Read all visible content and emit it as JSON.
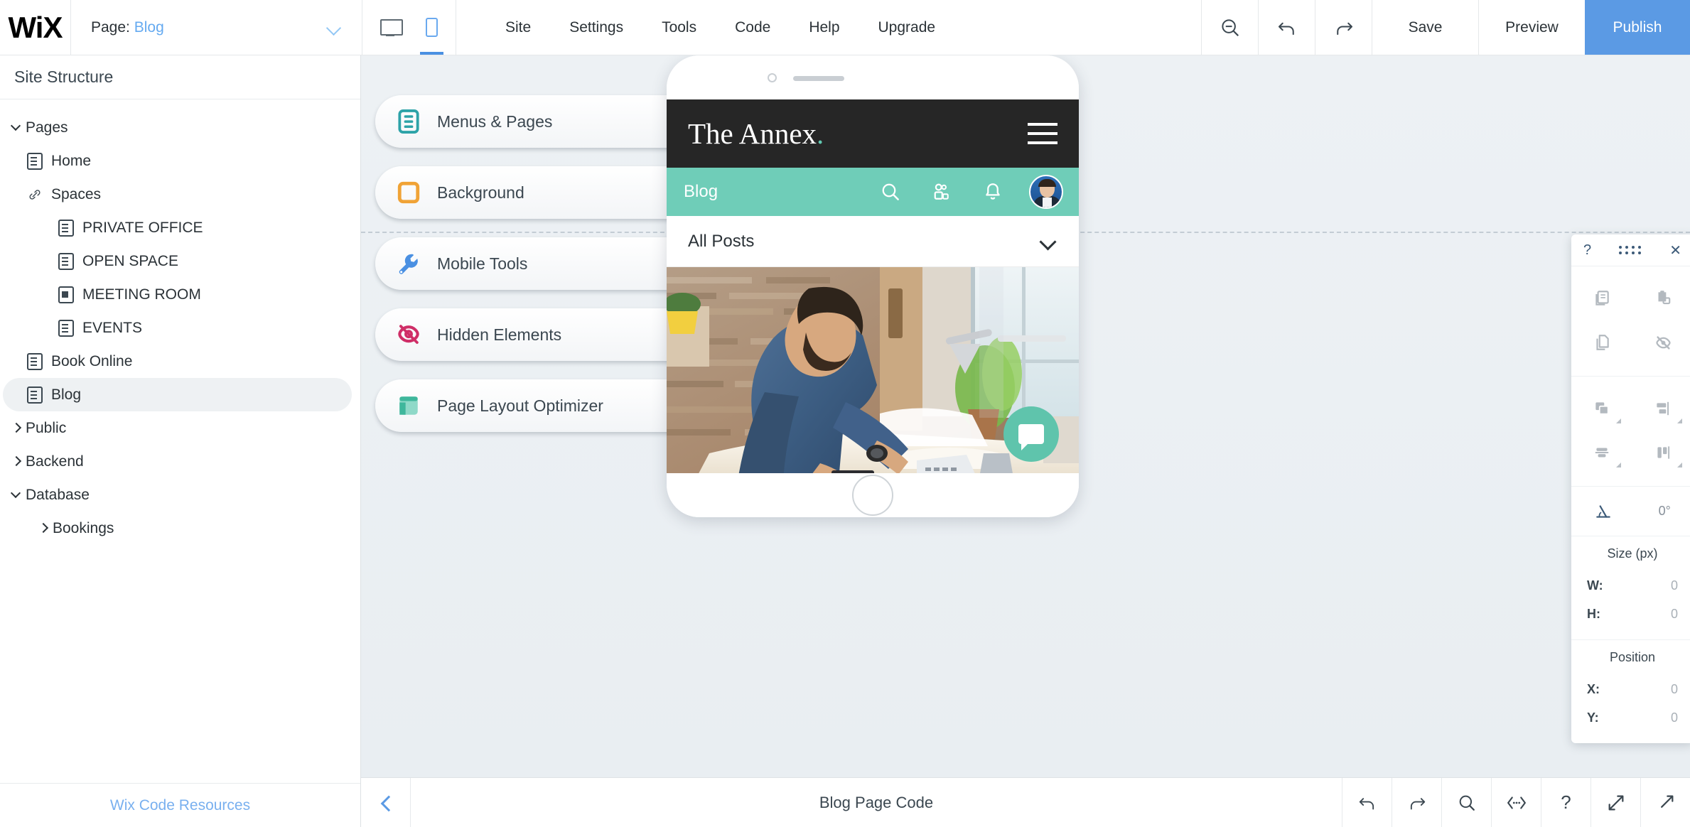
{
  "topbar": {
    "logo": "WiX",
    "page_prefix": "Page:",
    "page_name": "Blog",
    "devices": [
      {
        "name": "desktop-view",
        "label": "Desktop",
        "active": false
      },
      {
        "name": "mobile-view",
        "label": "Mobile",
        "active": true
      }
    ],
    "menu": [
      "Site",
      "Settings",
      "Tools",
      "Code",
      "Help",
      "Upgrade"
    ],
    "zoom_out_label": "Zoom Out",
    "undo_label": "Undo",
    "redo_label": "Redo",
    "save_label": "Save",
    "preview_label": "Preview",
    "publish_label": "Publish",
    "publish_color": "#5b9ae4"
  },
  "sidebar": {
    "title": "Site Structure",
    "footer_link": "Wix Code Resources",
    "tree": [
      {
        "label": "Pages",
        "indent": 0,
        "icon": "caret-down",
        "expanded": true,
        "selected": false
      },
      {
        "label": "Home",
        "indent": 1,
        "icon": "page",
        "selected": false
      },
      {
        "label": "Spaces",
        "indent": 1,
        "icon": "link",
        "selected": false
      },
      {
        "label": "PRIVATE OFFICE",
        "indent": 2,
        "icon": "page",
        "selected": false
      },
      {
        "label": "OPEN SPACE",
        "indent": 2,
        "icon": "page",
        "selected": false
      },
      {
        "label": "MEETING ROOM",
        "indent": 2,
        "icon": "page",
        "selected": false
      },
      {
        "label": "EVENTS",
        "indent": 2,
        "icon": "page",
        "selected": false
      },
      {
        "label": "Book Online",
        "indent": 1,
        "icon": "page",
        "selected": false
      },
      {
        "label": "Blog",
        "indent": 1,
        "icon": "page",
        "selected": true
      },
      {
        "label": "Public",
        "indent": 0,
        "icon": "caret-right",
        "expanded": false,
        "selected": false
      },
      {
        "label": "Backend",
        "indent": 0,
        "icon": "caret-right",
        "expanded": false,
        "selected": false
      },
      {
        "label": "Database",
        "indent": 0,
        "icon": "caret-down",
        "expanded": true,
        "selected": false
      },
      {
        "label": "Bookings",
        "indent": 1,
        "icon": "caret-right",
        "expanded": false,
        "selected": false
      }
    ]
  },
  "canvas": {
    "pills": [
      {
        "label": "Menus & Pages",
        "icon": "menus-pages-icon",
        "color": "#2da3a8"
      },
      {
        "label": "Background",
        "icon": "background-icon",
        "color": "#f0a336"
      },
      {
        "label": "Mobile Tools",
        "icon": "wrench-icon",
        "color": "#4a90e2"
      },
      {
        "label": "Hidden Elements",
        "icon": "hidden-eye-icon",
        "color": "#cf2e67"
      },
      {
        "label": "Page Layout Optimizer",
        "icon": "layout-icon",
        "color": "#5fc4ac"
      }
    ]
  },
  "phone": {
    "site_title": "The Annex",
    "site_title_accent": ".",
    "nav_title": "Blog",
    "nav_icons": [
      "search-icon",
      "members-icon",
      "bell-icon"
    ],
    "posts_filter": "All Posts",
    "header_bg": "#262626",
    "nav_bg": "#6fcdb8",
    "accent": "#62c9b2",
    "chat_fab_color": "#5fc4ac"
  },
  "right_panel": {
    "help_label": "?",
    "drag_label": "Drag",
    "close_label": "✕",
    "actions": [
      {
        "name": "duplicate-icon",
        "label": "Duplicate"
      },
      {
        "name": "paste-icon",
        "label": "Paste"
      },
      {
        "name": "copy-icon",
        "label": "Copy"
      },
      {
        "name": "hide-icon",
        "label": "Hide"
      }
    ],
    "arrange": [
      {
        "name": "arrange-layers-icon",
        "label": "Arrange"
      },
      {
        "name": "align-horizontal-icon",
        "label": "Align Horizontally"
      },
      {
        "name": "distribute-icon",
        "label": "Distribute"
      },
      {
        "name": "align-vertical-icon",
        "label": "Align Vertically"
      }
    ],
    "rotation_icon": "angle-icon",
    "rotation_value": "0°",
    "size_caption": "Size (px)",
    "size_fields": [
      {
        "key": "W:",
        "value": "0"
      },
      {
        "key": "H:",
        "value": "0"
      }
    ],
    "position_caption": "Position",
    "position_fields": [
      {
        "key": "X:",
        "value": "0"
      },
      {
        "key": "Y:",
        "value": "0"
      }
    ]
  },
  "bottombar": {
    "back_label": "Collapse",
    "title": "Blog Page Code",
    "icons": [
      {
        "name": "undo-icon",
        "label": "Undo"
      },
      {
        "name": "redo-icon",
        "label": "Redo"
      },
      {
        "name": "search-icon",
        "label": "Search"
      },
      {
        "name": "format-code-icon",
        "label": "Format Code"
      },
      {
        "name": "help-icon",
        "label": "Help"
      },
      {
        "name": "expand-icon",
        "label": "Expand"
      }
    ]
  }
}
